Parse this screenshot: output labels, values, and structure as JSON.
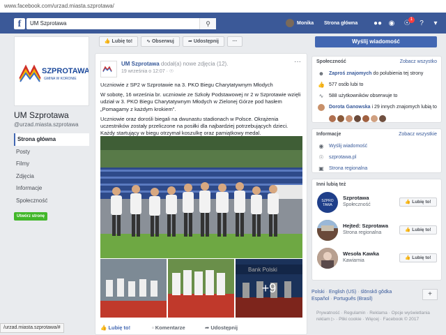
{
  "browser": {
    "url": "www.facebook.com/urzad.miasta.szprotawa/"
  },
  "topbar": {
    "search_value": "UM Szprotawa",
    "user_name": "Monika",
    "home_label": "Strona główna",
    "notif_count": "1"
  },
  "page": {
    "logo_name": "SZPROTAWA",
    "logo_tagline": "GMINA W KORONIE",
    "name": "UM Szprotawa",
    "handle": "@urzad.miasta.szprotawa",
    "nav": [
      "Strona główna",
      "Posty",
      "Filmy",
      "Zdjęcia",
      "Informacje",
      "Społeczność"
    ],
    "create_btn": "Utwórz stronę"
  },
  "actions": {
    "like": "Lubię to!",
    "follow": "Obserwuj",
    "share": "Udostępnij",
    "more": "···",
    "send_message": "Wyślij wiadomość"
  },
  "post": {
    "author": "UM Szprotawa",
    "action_text": "dodał(a) nowe zdjęcia (12).",
    "time": "19 września o 12:07 · ",
    "paragraphs": [
      "Uczniowie z SP2 w Szprotawie na 3. PKO Biegu Charytatywnym Młodych",
      "W sobotę, 16 września br. uczniowie ze Szkoły Podstawowej nr 2 w Szprotawie wzięli udział w 3. PKO Biegu Charytatywnym Młodych w Zielonej Górze pod hasłem „Pomagamy z każdym krokiem”.",
      "Uczniowie oraz dorośli biegali na dwunastu stadionach w Polsce. Okrążenia uczestników zostały przeliczone na posiłki dla najbardziej potrzebujących dzieci. Każdy startujący w biegu otrzymał koszulkę oraz pamiątkowy medal."
    ],
    "banner_text": "Bank Polski",
    "extra_photos": "+9",
    "like": "Lubię to!",
    "comment": "Komentarze",
    "share": "Udostępnij"
  },
  "community": {
    "title": "Społeczność",
    "link": "Zobacz wszystko",
    "invite_bold": "Zaproś znajomych",
    "invite_rest": "do polubienia tej strony",
    "likes": "577 osób lubi to",
    "followers": "588 użytkowników obserwuje to",
    "friend_bold": "Dorota Ganowska",
    "friend_rest": "i 29 innych znajomych lubią to",
    "face_colors": [
      "#b07050",
      "#8a5a3a",
      "#c89070",
      "#6a4a3a",
      "#a06040",
      "#d0a080",
      "#705040"
    ]
  },
  "info": {
    "title": "Informacje",
    "link": "Zobacz wszystkie",
    "send": "Wyślij wiadomość",
    "site": "szprotawa.pl",
    "category": "Strona regionalna"
  },
  "liked": {
    "title": "Inni lubią też",
    "items": [
      {
        "name": "Szprotawa",
        "cat": "Społeczność",
        "btn": "Lubię to!",
        "avatar_text": "SZPRO TAWA"
      },
      {
        "name": "Hejted: Szprotawa",
        "cat": "Strona regionalna",
        "btn": "Lubię to!"
      },
      {
        "name": "Wesoła Kawka",
        "cat": "Kawiarnia",
        "btn": "Lubię to!"
      }
    ]
  },
  "languages": {
    "list": [
      "Polski",
      "English (US)",
      "ślōnskŏ gŏdka",
      "Español",
      "Português (Brasil)"
    ],
    "add": "+"
  },
  "footer": {
    "text": "Prywatność · Regulamin · Reklama · Opcje wyświetlania reklam ▷ · Pliki cookie · Więcej · Facebook © 2017"
  },
  "status_url": "/urzad.miasta.szprotawa/#"
}
